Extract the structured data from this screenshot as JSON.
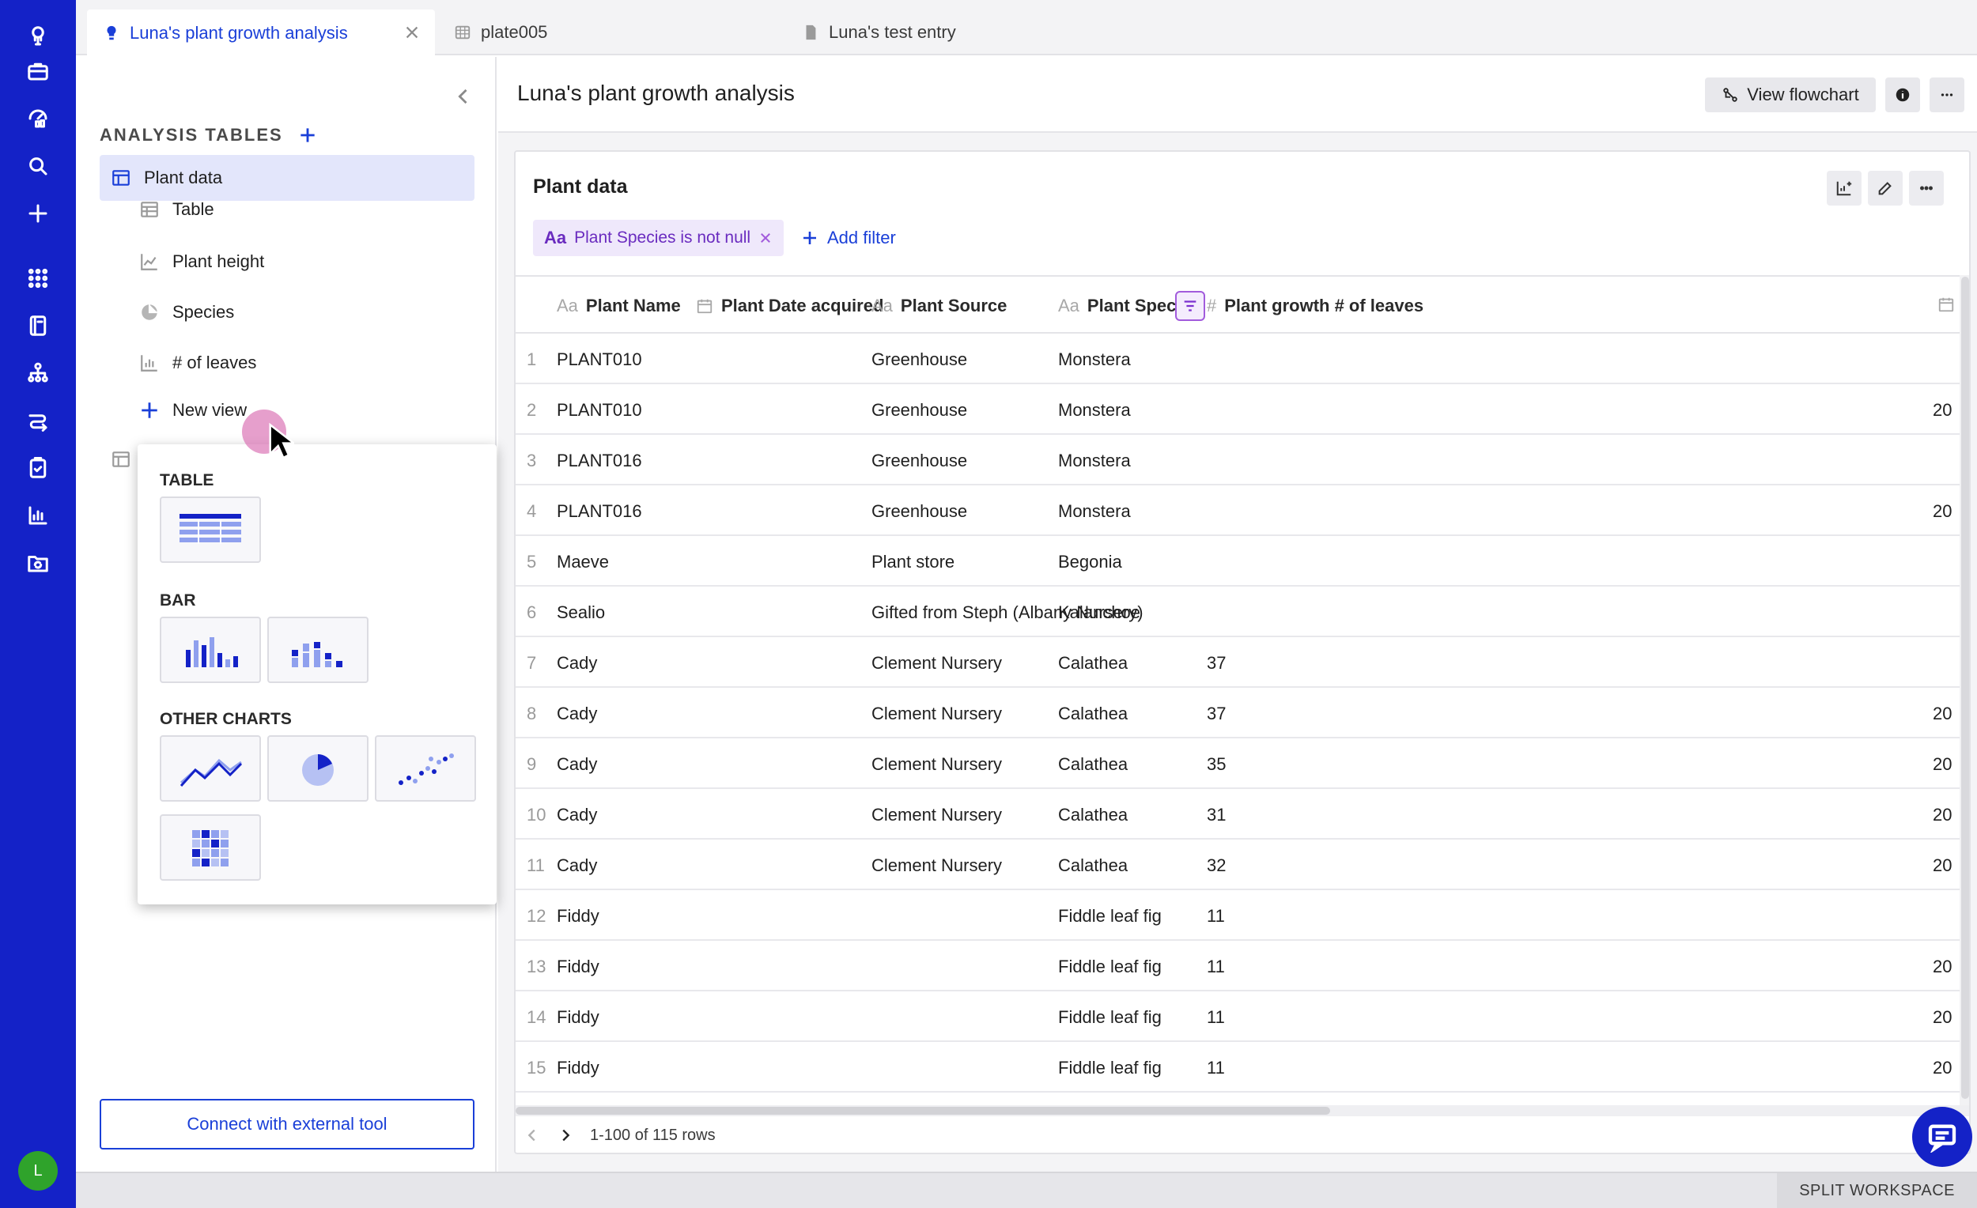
{
  "tabs": [
    {
      "label": "Luna's plant growth analysis",
      "icon": "bulb-icon"
    },
    {
      "label": "plate005",
      "icon": "plate-icon"
    },
    {
      "label": "Luna's test entry",
      "icon": "document-icon"
    }
  ],
  "rail": {
    "icons": [
      "brand-logo-icon",
      "briefcase-icon",
      "dashboard-icon",
      "search-icon",
      "plus-icon",
      "apps-grid-icon",
      "notebook-icon",
      "hierarchy-icon",
      "workflow-icon",
      "clipboard-check-icon",
      "bar-chart-icon",
      "folder-sync-icon"
    ],
    "avatar_initial": "L"
  },
  "sidebar": {
    "section_title": "ANALYSIS TABLES",
    "selected_table": "Plant data",
    "views": [
      {
        "label": "Table",
        "icon": "table-icon"
      },
      {
        "label": "Plant height",
        "icon": "line-chart-icon"
      },
      {
        "label": "Species",
        "icon": "pie-chart-icon"
      },
      {
        "label": "# of leaves",
        "icon": "bar-chart-icon"
      }
    ],
    "new_view_label": "New view",
    "connect_label": "Connect with external tool"
  },
  "popup": {
    "table_heading": "TABLE",
    "bar_heading": "BAR",
    "other_heading": "OTHER CHARTS",
    "tiles": {
      "table": [
        "table-view-icon"
      ],
      "bar": [
        "bar-chart-icon",
        "grouped-bar-chart-icon"
      ],
      "other": [
        "line-chart-icon",
        "pie-chart-icon",
        "scatter-plot-icon",
        "heatmap-icon"
      ]
    }
  },
  "main": {
    "title": "Luna's plant growth analysis",
    "view_flowchart_label": "View flowchart",
    "card_title": "Plant data",
    "filter_chip": {
      "type_glyph": "Aa",
      "text": "Plant Species is not null"
    },
    "add_filter_label": "Add filter",
    "columns": [
      {
        "type_glyph": "Aa",
        "label": "Plant Name"
      },
      {
        "type_glyph": "calendar",
        "label": "Plant Date acquired"
      },
      {
        "type_glyph": "Aa",
        "label": "Plant Source"
      },
      {
        "type_glyph": "Aa",
        "label": "Plant Species"
      },
      {
        "type_glyph": "#",
        "label": "Plant growth # of leaves"
      }
    ],
    "rows": [
      {
        "n": "1",
        "name": "PLANT010",
        "date": "",
        "source": "Greenhouse",
        "species": "Monstera",
        "leaves": "",
        "more": ""
      },
      {
        "n": "2",
        "name": "PLANT010",
        "date": "",
        "source": "Greenhouse",
        "species": "Monstera",
        "leaves": "",
        "more": "20"
      },
      {
        "n": "3",
        "name": "PLANT016",
        "date": "",
        "source": "Greenhouse",
        "species": "Monstera",
        "leaves": "",
        "more": ""
      },
      {
        "n": "4",
        "name": "PLANT016",
        "date": "",
        "source": "Greenhouse",
        "species": "Monstera",
        "leaves": "",
        "more": "20"
      },
      {
        "n": "5",
        "name": "Maeve",
        "date": "",
        "source": "Plant store",
        "species": "Begonia",
        "leaves": "",
        "more": ""
      },
      {
        "n": "6",
        "name": "Sealio",
        "date": "",
        "source": "Gifted from Steph (Albany Nursery)",
        "species": "Kalanchoe",
        "leaves": "",
        "more": ""
      },
      {
        "n": "7",
        "name": "Cady",
        "date": "",
        "source": "Clement Nursery",
        "species": "Calathea",
        "leaves": "37",
        "more": ""
      },
      {
        "n": "8",
        "name": "Cady",
        "date": "",
        "source": "Clement Nursery",
        "species": "Calathea",
        "leaves": "37",
        "more": "20"
      },
      {
        "n": "9",
        "name": "Cady",
        "date": "",
        "source": "Clement Nursery",
        "species": "Calathea",
        "leaves": "35",
        "more": "20"
      },
      {
        "n": "10",
        "name": "Cady",
        "date": "",
        "source": "Clement Nursery",
        "species": "Calathea",
        "leaves": "31",
        "more": "20"
      },
      {
        "n": "11",
        "name": "Cady",
        "date": "",
        "source": "Clement Nursery",
        "species": "Calathea",
        "leaves": "32",
        "more": "20"
      },
      {
        "n": "12",
        "name": "Fiddy",
        "date": "",
        "source": "",
        "species": "Fiddle leaf fig",
        "leaves": "11",
        "more": ""
      },
      {
        "n": "13",
        "name": "Fiddy",
        "date": "",
        "source": "",
        "species": "Fiddle leaf fig",
        "leaves": "11",
        "more": "20"
      },
      {
        "n": "14",
        "name": "Fiddy",
        "date": "",
        "source": "",
        "species": "Fiddle leaf fig",
        "leaves": "11",
        "more": "20"
      },
      {
        "n": "15",
        "name": "Fiddy",
        "date": "",
        "source": "",
        "species": "Fiddle leaf fig",
        "leaves": "11",
        "more": "20"
      }
    ],
    "pagination": "1-100 of 115 rows"
  },
  "statusbar": {
    "split_workspace": "SPLIT WORKSPACE"
  },
  "colors": {
    "rail": "#1422c7",
    "accent": "#1a3fd8",
    "filter": "#7b2fd0",
    "selected_bg": "#e3e6fb"
  }
}
